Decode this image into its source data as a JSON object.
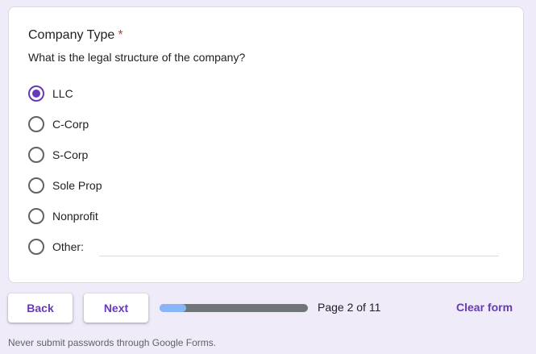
{
  "question": {
    "title": "Company Type",
    "required_marker": "*",
    "description": "What is the legal structure of the company?"
  },
  "options": [
    {
      "label": "LLC",
      "selected": true
    },
    {
      "label": "C-Corp",
      "selected": false
    },
    {
      "label": "S-Corp",
      "selected": false
    },
    {
      "label": "Sole Prop",
      "selected": false
    },
    {
      "label": "Nonprofit",
      "selected": false
    },
    {
      "label": "Other:",
      "selected": false,
      "other_value": ""
    }
  ],
  "nav": {
    "back_label": "Back",
    "next_label": "Next",
    "page_text": "Page 2 of 11",
    "progress": 0.18,
    "clear_label": "Clear form"
  },
  "footer": {
    "text": "Never submit passwords through Google Forms."
  },
  "colors": {
    "accent": "#673ab7",
    "background": "#f0ebf8",
    "required": "#d93025",
    "progress_fill": "#8ab4f8",
    "progress_track": "#70757a"
  }
}
